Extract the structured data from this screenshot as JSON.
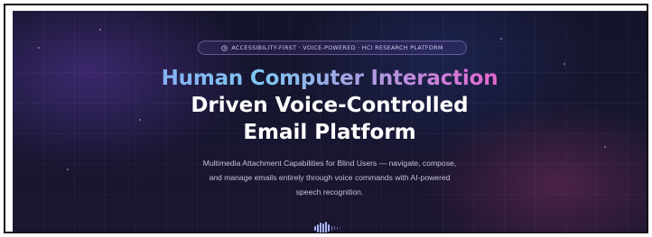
{
  "badge": {
    "icon": "clock-icon",
    "text": "ACCESSIBILITY-FIRST · VOICE-POWERED · HCI RESEARCH PLATFORM"
  },
  "hero": {
    "title_line1": "Human Computer Interaction",
    "title_line2": "Driven Voice-Controlled",
    "title_line3": "Email Platform",
    "description_line1": "Multimedia Attachment Capabilities for Blind Users — navigate, compose,",
    "description_line2": "and manage emails entirely through voice commands with AI-powered",
    "description_line3": "speech recognition."
  },
  "waveform": {
    "icon": "audio-waveform-icon"
  },
  "colors": {
    "background": "#161630",
    "title_gradient_start": "#8f8ff2",
    "title_gradient_mid": "#7fc7f2",
    "title_gradient_end": "#ee5aa8",
    "title_white": "#ffffff",
    "description": "#c4c4d6",
    "badge_text": "#cfc7ee",
    "waveform": "#a9b4ff"
  }
}
